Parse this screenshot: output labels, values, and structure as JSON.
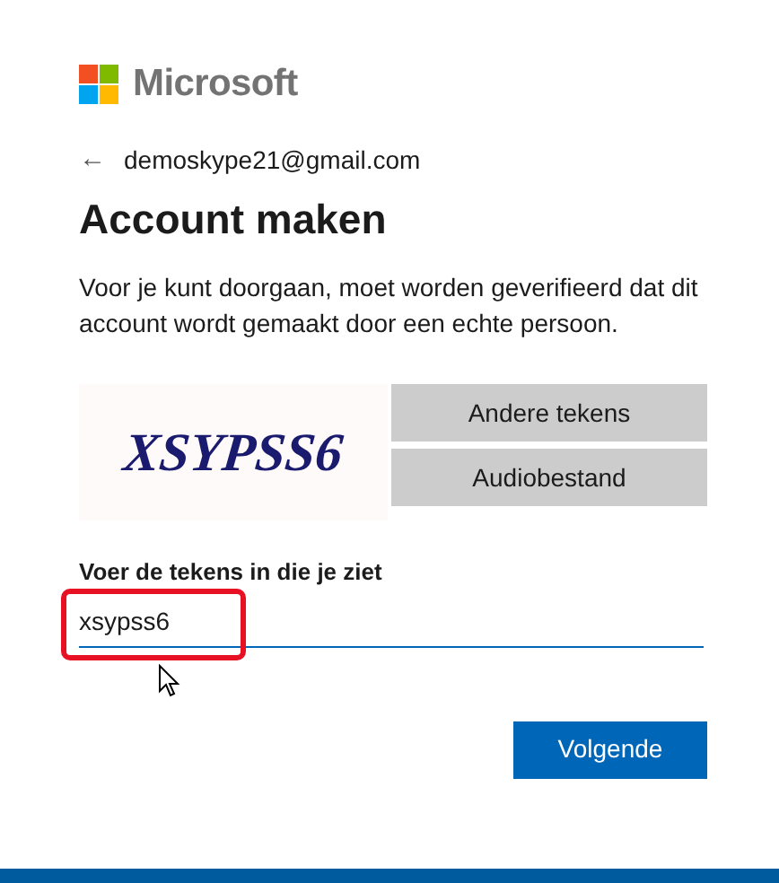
{
  "brand": "Microsoft",
  "back": {
    "icon": "←",
    "email": "demoskype21@gmail.com"
  },
  "title": "Account maken",
  "description": "Voor je kunt doorgaan, moet worden geverifieerd dat dit account wordt gemaakt door een echte persoon.",
  "captcha": {
    "text": "XSYPSS6",
    "buttons": [
      "Andere tekens",
      "Audiobestand"
    ]
  },
  "field": {
    "label": "Voer de tekens in die je ziet",
    "value": "xsypss6",
    "highlighted": true
  },
  "next_button": "Volgende"
}
